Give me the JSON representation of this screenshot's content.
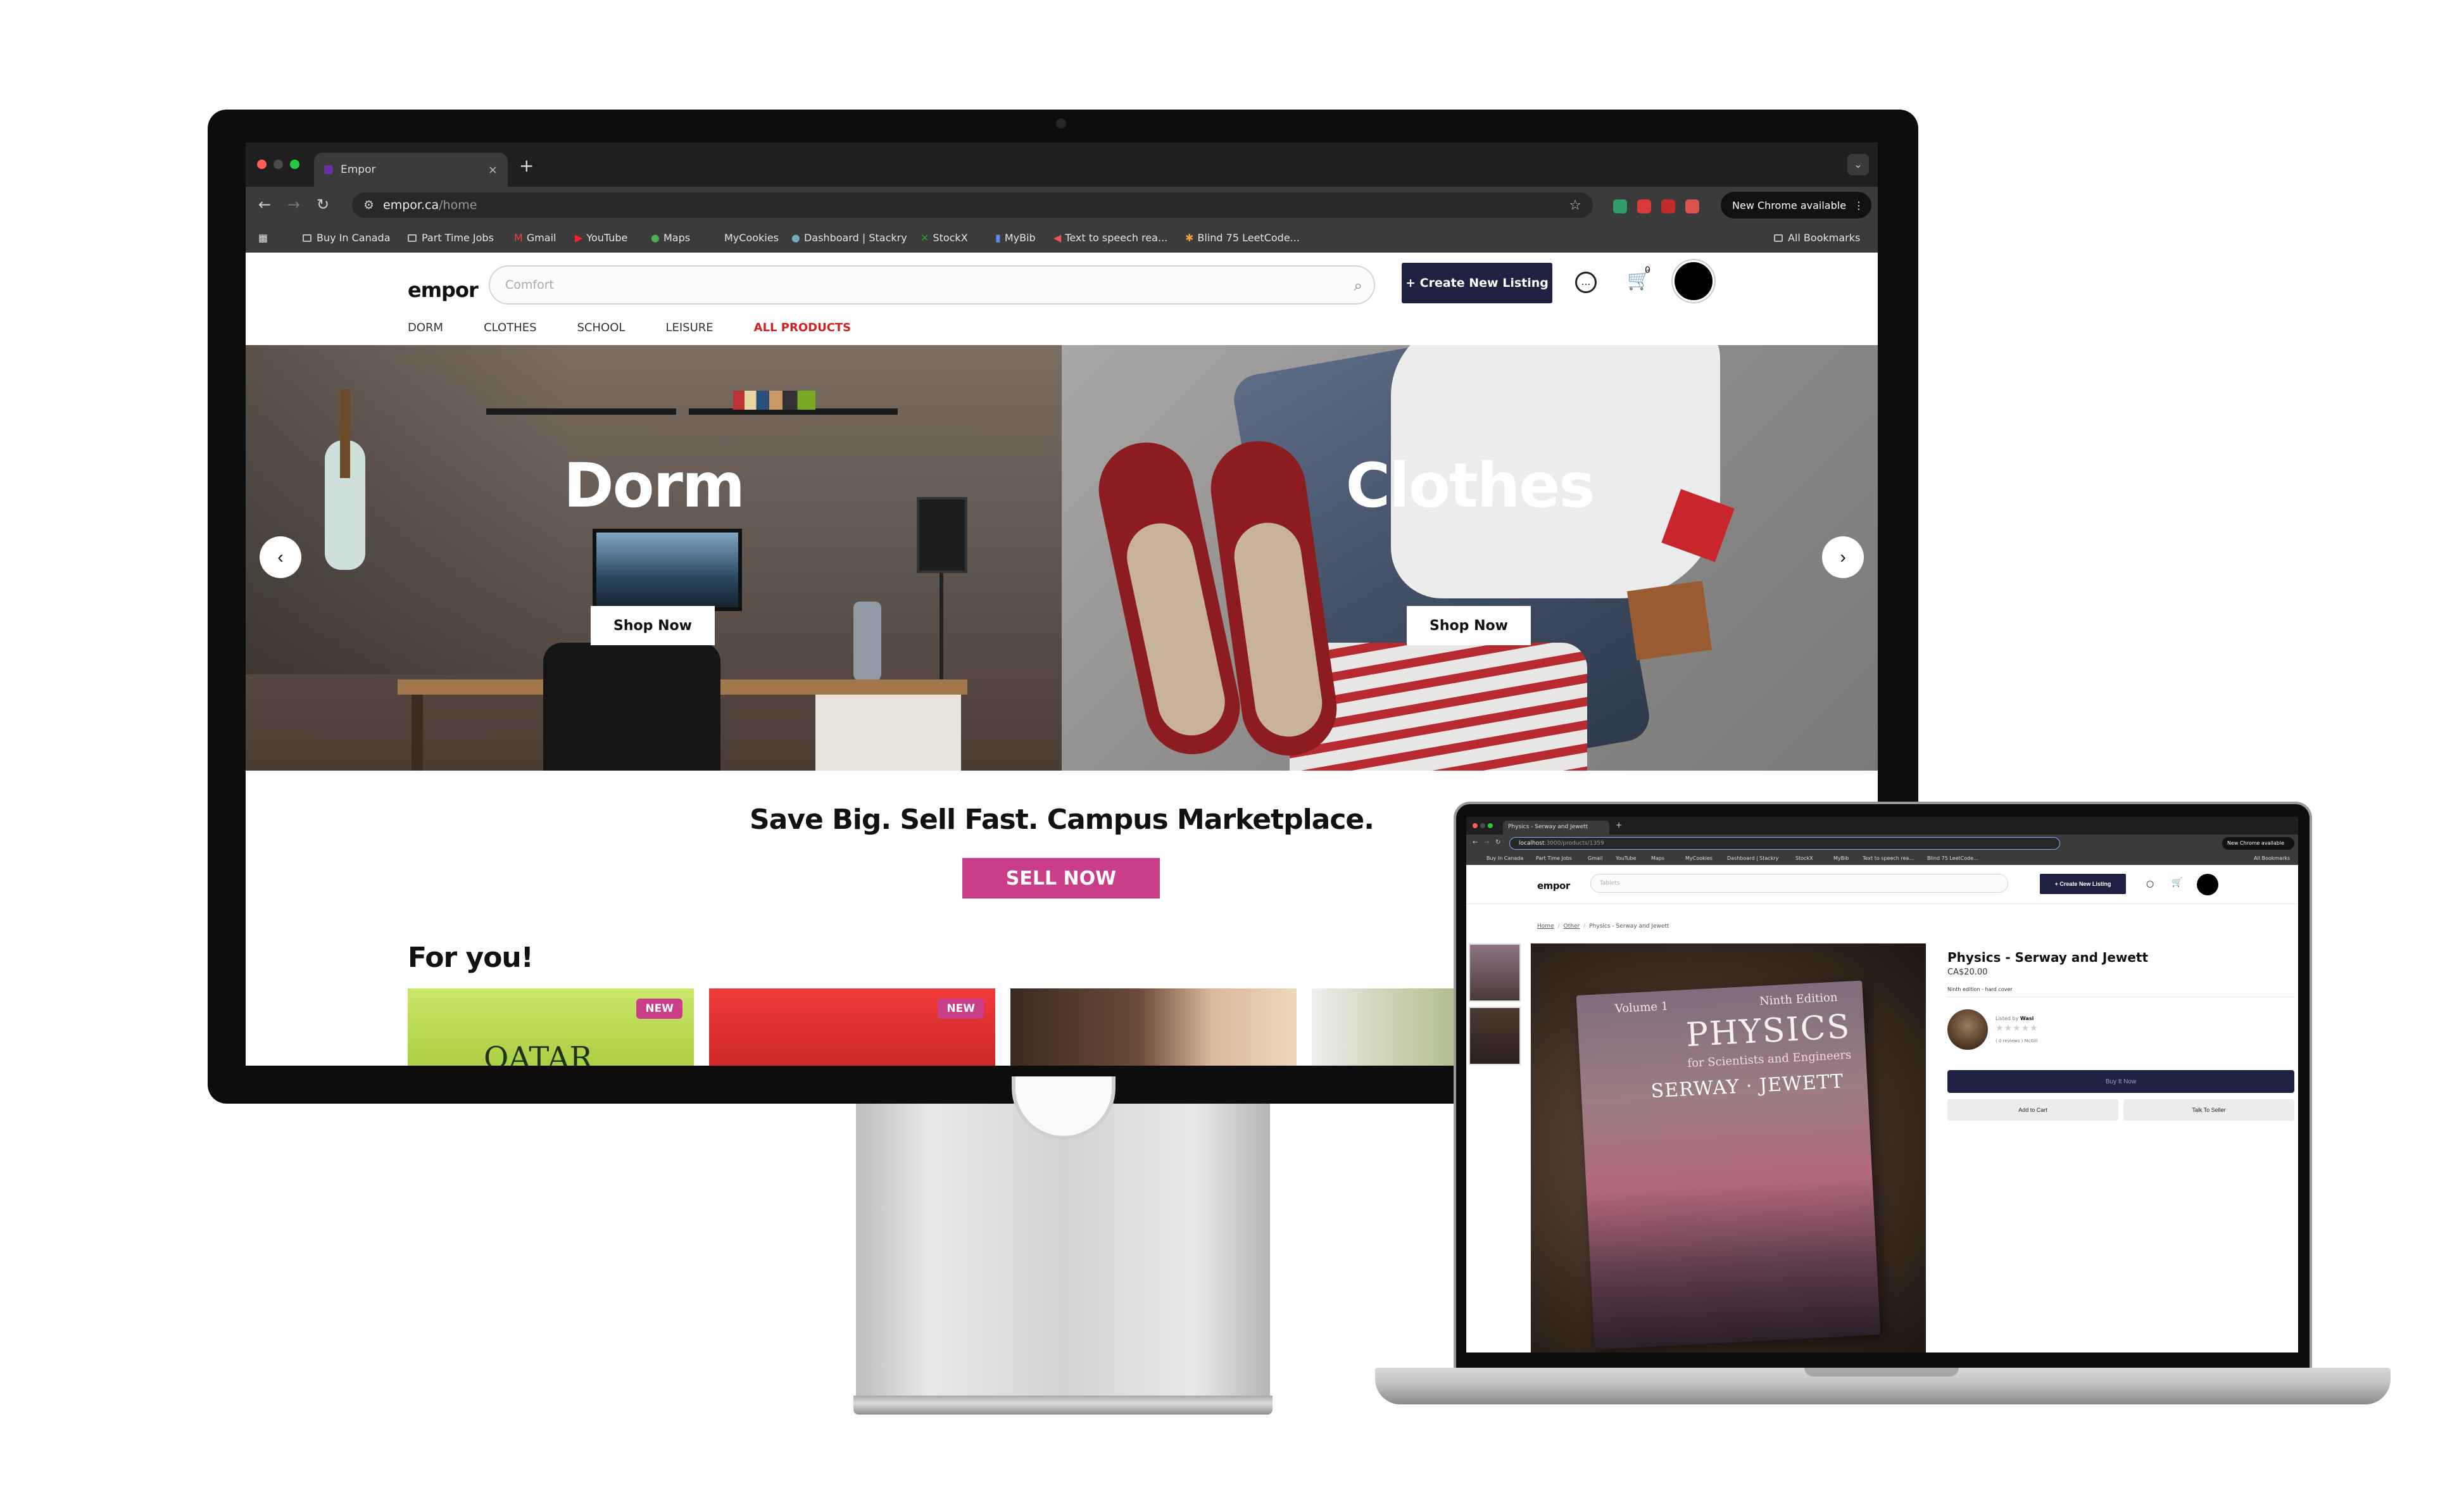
{
  "desktop": {
    "browser": {
      "tab_title": "Empor",
      "tab_close": "×",
      "new_tab": "+",
      "url_host": "empor.ca",
      "url_path": "/home",
      "new_chrome": "New Chrome available",
      "bookmarks": [
        "Buy In Canada",
        "Part Time Jobs",
        "Gmail",
        "YouTube",
        "Maps",
        "MyCookies",
        "Dashboard | Stackry",
        "StockX",
        "MyBib",
        "Text to speech rea...",
        "Blind 75 LeetCode..."
      ],
      "all_bookmarks": "All Bookmarks"
    },
    "site": {
      "logo": "empor",
      "search_placeholder": "Comfort",
      "create_listing": "+ Create New Listing",
      "cart_count": "0",
      "categories": [
        "DORM",
        "CLOTHES",
        "SCHOOL",
        "LEISURE",
        "ALL PRODUCTS"
      ],
      "hero": [
        {
          "title": "Dorm",
          "cta": "Shop Now"
        },
        {
          "title": "Clothes",
          "cta": "Shop Now"
        }
      ],
      "prev_arrow": "‹",
      "next_arrow": "›",
      "tagline": "Save Big. Sell Fast. Campus Marketplace.",
      "sell_now": "SELL NOW",
      "for_you": "For you!",
      "product_cards": [
        {
          "badge": "NEW",
          "shirt_text": "QATAR"
        },
        {
          "badge": "NEW"
        },
        {},
        {}
      ]
    }
  },
  "laptop": {
    "browser": {
      "tab_title": "Physics - Serway and Jewett",
      "url_host": "localhost",
      "url_path": ":3000/products/1359",
      "new_chrome": "New Chrome available",
      "bookmarks": [
        "Buy In Canada",
        "Part Time Jobs",
        "Gmail",
        "YouTube",
        "Maps",
        "MyCookies",
        "Dashboard | Stackry",
        "StockX",
        "MyBib",
        "Text to speech rea...",
        "Blind 75 LeetCode..."
      ],
      "all_bookmarks": "All Bookmarks"
    },
    "site": {
      "logo": "empor",
      "search_placeholder": "Tablets",
      "create_listing": "+ Create New Listing",
      "breadcrumb": [
        "Home",
        "Other",
        "Physics - Serway and Jewett"
      ],
      "product": {
        "title": "Physics - Serway and Jewett",
        "price": "CA$20.00",
        "description": "Ninth edition - hard cover",
        "listed_by_label": "Listed by",
        "seller": "Wasi",
        "stars": "★★★★★",
        "reviews": "( 0 reviews ) McGill",
        "buy_now": "Buy It Now",
        "add_to_cart": "Add to Cart",
        "talk_to_seller": "Talk To Seller"
      },
      "book_cover": {
        "volume": "Volume 1",
        "edition": "Ninth Edition",
        "title": "PHYSICS",
        "subtitle": "for Scientists and Engineers",
        "authors": "SERWAY · JEWETT"
      }
    }
  },
  "colors": {
    "brand_navy": "#1e2142",
    "sell_pink": "#c93e86",
    "active_category": "#d42020"
  }
}
